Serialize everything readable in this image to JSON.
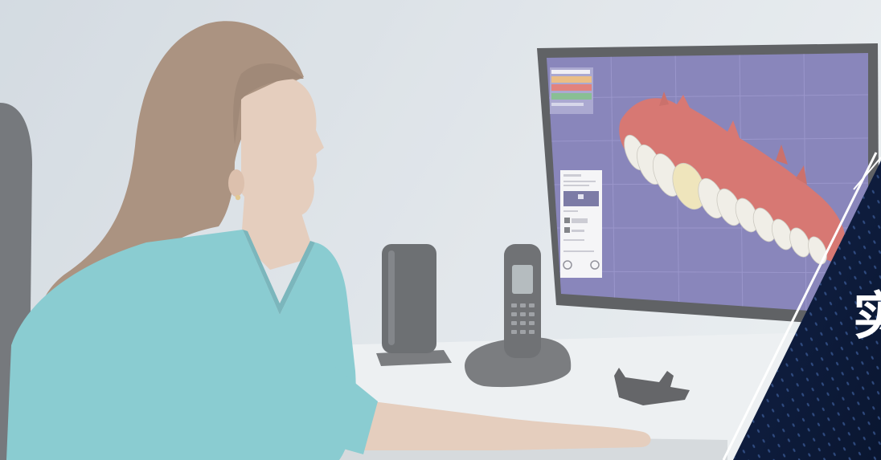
{
  "banner": {
    "heading": "实"
  },
  "colors": {
    "wall": "#d3dbe2",
    "panel": "#0e1c3c",
    "panel_dots": "#3a5b96",
    "panel_edge": "#ffffff",
    "scrubs": "#5fb9c0",
    "hair": "#8d6c53",
    "skin": "#dcbca6",
    "screen": "#5e59a2",
    "gums": "#c9473f",
    "teeth": "#ebe8de",
    "desk": "#e7ebee",
    "device": "#3a3d42"
  }
}
